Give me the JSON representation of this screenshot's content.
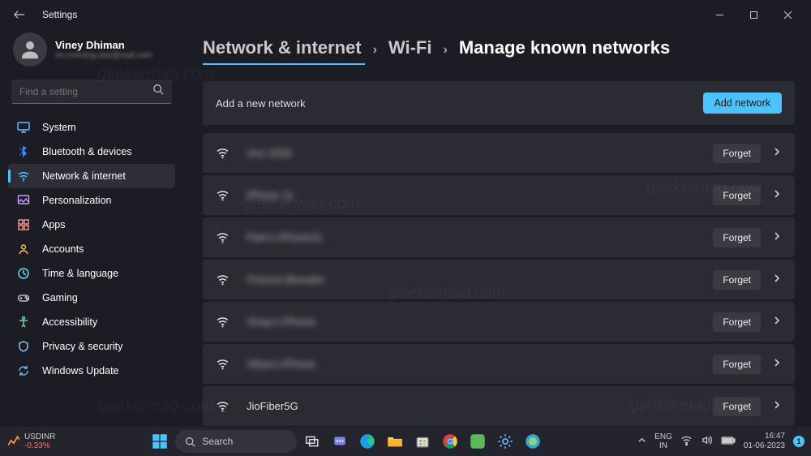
{
  "window": {
    "title": "Settings"
  },
  "profile": {
    "name": "Viney Dhiman",
    "email": "mr.morning.star@mail.com"
  },
  "search": {
    "placeholder": "Find a setting"
  },
  "sidebar": {
    "items": [
      {
        "label": "System"
      },
      {
        "label": "Bluetooth & devices"
      },
      {
        "label": "Network & internet"
      },
      {
        "label": "Personalization"
      },
      {
        "label": "Apps"
      },
      {
        "label": "Accounts"
      },
      {
        "label": "Time & language"
      },
      {
        "label": "Gaming"
      },
      {
        "label": "Accessibility"
      },
      {
        "label": "Privacy & security"
      },
      {
        "label": "Windows Update"
      }
    ]
  },
  "breadcrumb": {
    "a": "Network & internet",
    "b": "Wi-Fi",
    "c": "Manage known networks"
  },
  "add": {
    "label": "Add a new network",
    "button": "Add network"
  },
  "forget_label": "Forget",
  "networks": [
    {
      "name": "vivo 1818",
      "blurred": true
    },
    {
      "name": "iPhone 11",
      "blurred": true
    },
    {
      "name": "Pam's iPhone11",
      "blurred": true
    },
    {
      "name": "Fortune Besudm",
      "blurred": true
    },
    {
      "name": "Vinay's iPhone",
      "blurred": true
    },
    {
      "name": "Vikas's iPhone",
      "blurred": true
    },
    {
      "name": "JioFiber5G",
      "blurred": false
    }
  ],
  "taskbar": {
    "stock": {
      "symbol": "USDINR",
      "change": "-0.33%"
    },
    "search": "Search",
    "lang": {
      "a": "ENG",
      "b": "IN"
    },
    "time": "16:47",
    "date": "01-06-2023",
    "notif": "1"
  }
}
